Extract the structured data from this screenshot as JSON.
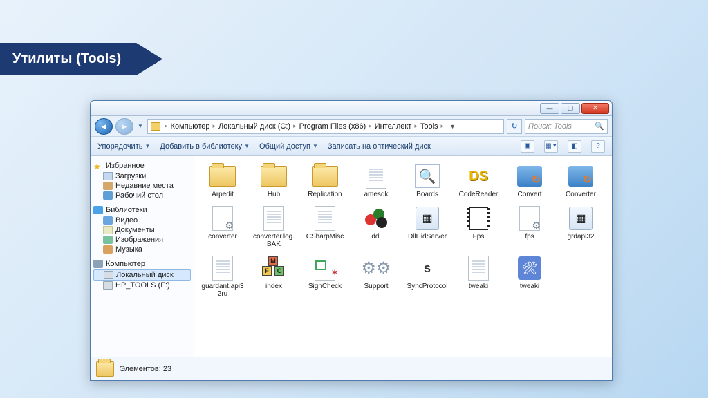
{
  "slide": {
    "title": "Утилиты (Tools)"
  },
  "window": {
    "controls": {
      "min": "—",
      "max": "▢",
      "close": "✕"
    },
    "nav": {
      "back": "◄",
      "forward": "►"
    },
    "breadcrumb": [
      "Компьютер",
      "Локальный диск (C:)",
      "Program Files (x86)",
      "Интеллект",
      "Tools"
    ],
    "search_placeholder": "Поиск: Tools",
    "toolbar": {
      "organize": "Упорядочить",
      "addlib": "Добавить в библиотеку",
      "share": "Общий доступ",
      "burn": "Записать на оптический диск"
    },
    "sidebar": {
      "favorites": {
        "head": "Избранное",
        "items": [
          "Загрузки",
          "Недавние места",
          "Рабочий стол"
        ]
      },
      "libraries": {
        "head": "Библиотеки",
        "items": [
          "Видео",
          "Документы",
          "Изображения",
          "Музыка"
        ]
      },
      "computer": {
        "head": "Компьютер",
        "items": [
          "Локальный диск",
          "HP_TOOLS (F:)"
        ]
      }
    },
    "files": [
      {
        "name": "Arpedit",
        "kind": "folder"
      },
      {
        "name": "Hub",
        "kind": "folder"
      },
      {
        "name": "Replication",
        "kind": "folder"
      },
      {
        "name": "amesdk",
        "kind": "page"
      },
      {
        "name": "Boards",
        "kind": "boards"
      },
      {
        "name": "CodeReader",
        "kind": "ds"
      },
      {
        "name": "Convert",
        "kind": "convert"
      },
      {
        "name": "Converter",
        "kind": "convert"
      },
      {
        "name": "converter",
        "kind": "cfg"
      },
      {
        "name": "converter.log.BAK",
        "kind": "page"
      },
      {
        "name": "CSharpMisc",
        "kind": "page"
      },
      {
        "name": "ddi",
        "kind": "ddi"
      },
      {
        "name": "DllHidServer",
        "kind": "app"
      },
      {
        "name": "Fps",
        "kind": "film"
      },
      {
        "name": "fps",
        "kind": "cfg"
      },
      {
        "name": "grdapi32",
        "kind": "app"
      },
      {
        "name": "guardant.api32ru",
        "kind": "page"
      },
      {
        "name": "index",
        "kind": "index"
      },
      {
        "name": "SignCheck",
        "kind": "cert"
      },
      {
        "name": "Support",
        "kind": "gears"
      },
      {
        "name": "SyncProtocol",
        "kind": "s"
      },
      {
        "name": "tweaki",
        "kind": "page"
      },
      {
        "name": "tweaki",
        "kind": "tweaki"
      }
    ],
    "status": "Элементов: 23"
  }
}
